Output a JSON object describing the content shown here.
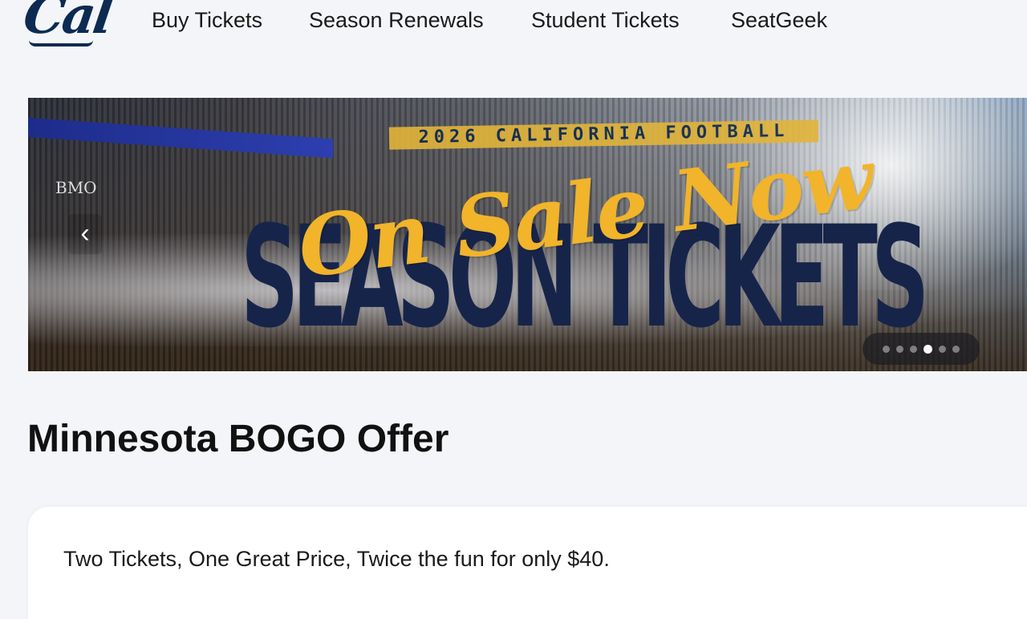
{
  "header": {
    "logo_text": "Cal",
    "nav": [
      {
        "label": "Buy Tickets"
      },
      {
        "label": "Season Renewals"
      },
      {
        "label": "Student Tickets"
      },
      {
        "label": "SeatGeek"
      }
    ]
  },
  "hero": {
    "banner_top": "2026 CALIFORNIA FOOTBALL",
    "script_text": "On Sale Now",
    "headline": "SEASON TICKETS",
    "stadium_sign": "BMO",
    "prev_icon": "chevron-left-icon",
    "slides_count": 6,
    "active_slide": 4
  },
  "main": {
    "title": "Minnesota BOGO Offer",
    "offer_text": "Two Tickets, One Great Price, Twice the fun for only $40."
  },
  "colors": {
    "brand_navy": "#0d2b52",
    "brand_gold": "#f1b42a",
    "page_bg": "#f3f5f9"
  }
}
